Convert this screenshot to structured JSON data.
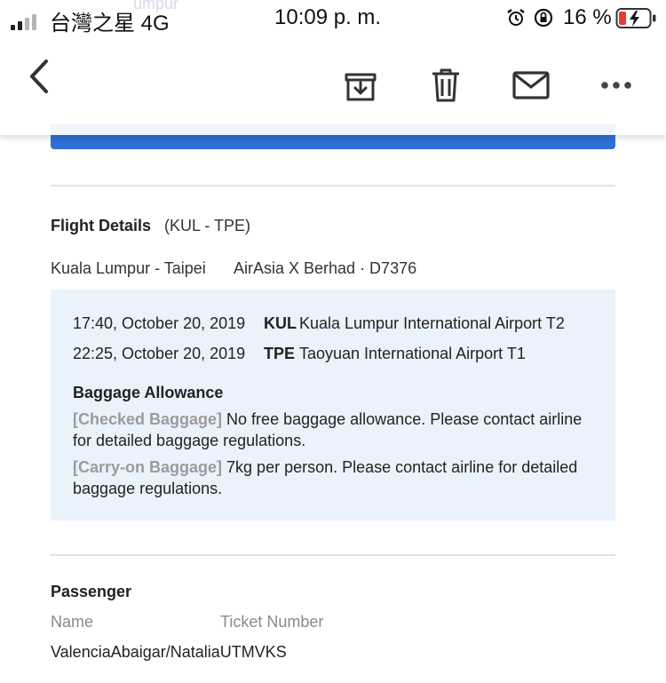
{
  "status_bar": {
    "carrier": "台灣之星 4G",
    "time": "10:09 p. m.",
    "battery_percent": "16 %",
    "battery_level": 0.16,
    "signal_bars": 2,
    "icons": [
      "alarm-icon",
      "rotation-lock-icon",
      "battery-charging-icon"
    ],
    "ghost_text": "umpur"
  },
  "toolbar": {
    "icons": [
      "back-chevron-icon",
      "archive-icon",
      "trash-icon",
      "mail-icon",
      "more-icon"
    ]
  },
  "flight": {
    "heading": "Flight Details",
    "route_code": "(KUL - TPE)",
    "route": "Kuala Lumpur - Taipei",
    "airline": "AirAsia X Berhad · D7376",
    "departure": {
      "datetime": "17:40, October 20, 2019",
      "code": "KUL",
      "airport": "Kuala Lumpur International Airport T2"
    },
    "arrival": {
      "datetime": "22:25, October 20, 2019",
      "code": "TPE",
      "airport": "Taoyuan International Airport T1"
    }
  },
  "baggage": {
    "heading": "Baggage Allowance",
    "checked_tag": "[Checked Baggage]",
    "checked_text": " No free baggage allowance. Please contact airline for detailed baggage regulations.",
    "carry_tag": "[Carry-on Baggage]",
    "carry_text": " 7kg per person. Please contact airline for detailed baggage regulations."
  },
  "passenger": {
    "heading": "Passenger",
    "col_name": "Name",
    "col_ticket": "Ticket Number",
    "name": "ValenciaAbaigar/NataliaUTMVKS"
  },
  "colors": {
    "accent_blue": "#2f6fd6",
    "info_box": "#eaf3fb",
    "battery_red": "#e53935"
  }
}
